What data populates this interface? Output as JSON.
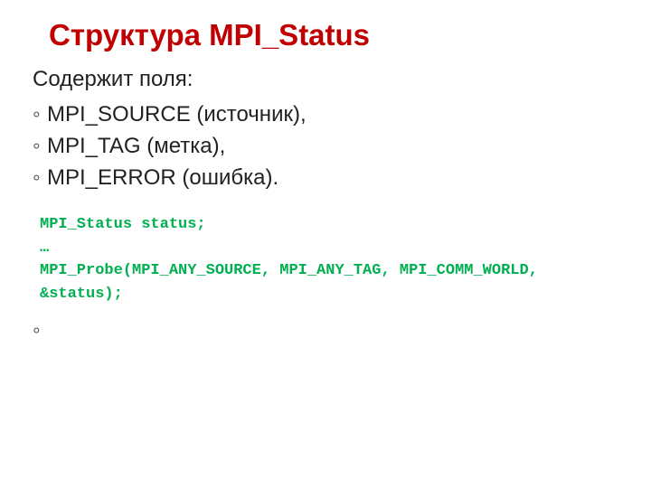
{
  "slide": {
    "title": "Структура MPI_Status",
    "intro": "Содержит поля:",
    "fields": [
      "MPI_SOURCE (источник),",
      "MPI_TAG (метка),",
      "MPI_ERROR (ошибка)."
    ],
    "code_lines": [
      "MPI_Status status;",
      "…",
      "MPI_Probe(MPI_ANY_SOURCE, MPI_ANY_TAG, MPI_COMM_WORLD, &status);"
    ],
    "trailing_bullet": ""
  }
}
